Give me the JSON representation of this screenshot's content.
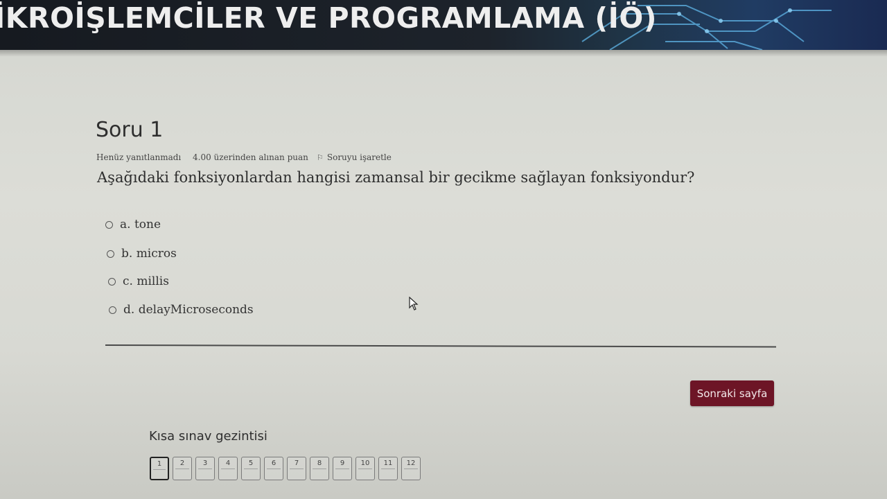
{
  "header": {
    "title": "İKROİŞLEMCİLER VE PROGRAMLAMA (İÖ)"
  },
  "question": {
    "title": "Soru 1",
    "status": "Henüz yanıtlanmadı",
    "points": "4.00 üzerinden alınan puan",
    "flag_label": "Soruyu işaretle",
    "text": "Aşağıdaki fonksiyonlardan hangisi zamansal bir gecikme sağlayan fonksiyondur?",
    "options": [
      {
        "label": "a. tone"
      },
      {
        "label": "b. micros"
      },
      {
        "label": "c. millis"
      },
      {
        "label": "d. delayMicroseconds"
      }
    ]
  },
  "actions": {
    "next_label": "Sonraki sayfa"
  },
  "navigation": {
    "title": "Kısa sınav gezintisi",
    "pages": [
      "1",
      "2",
      "3",
      "4",
      "5",
      "6",
      "7",
      "8",
      "9",
      "10",
      "11",
      "12"
    ],
    "current": "1"
  },
  "colors": {
    "accent": "#6d1526",
    "banner": "#1d232b"
  }
}
